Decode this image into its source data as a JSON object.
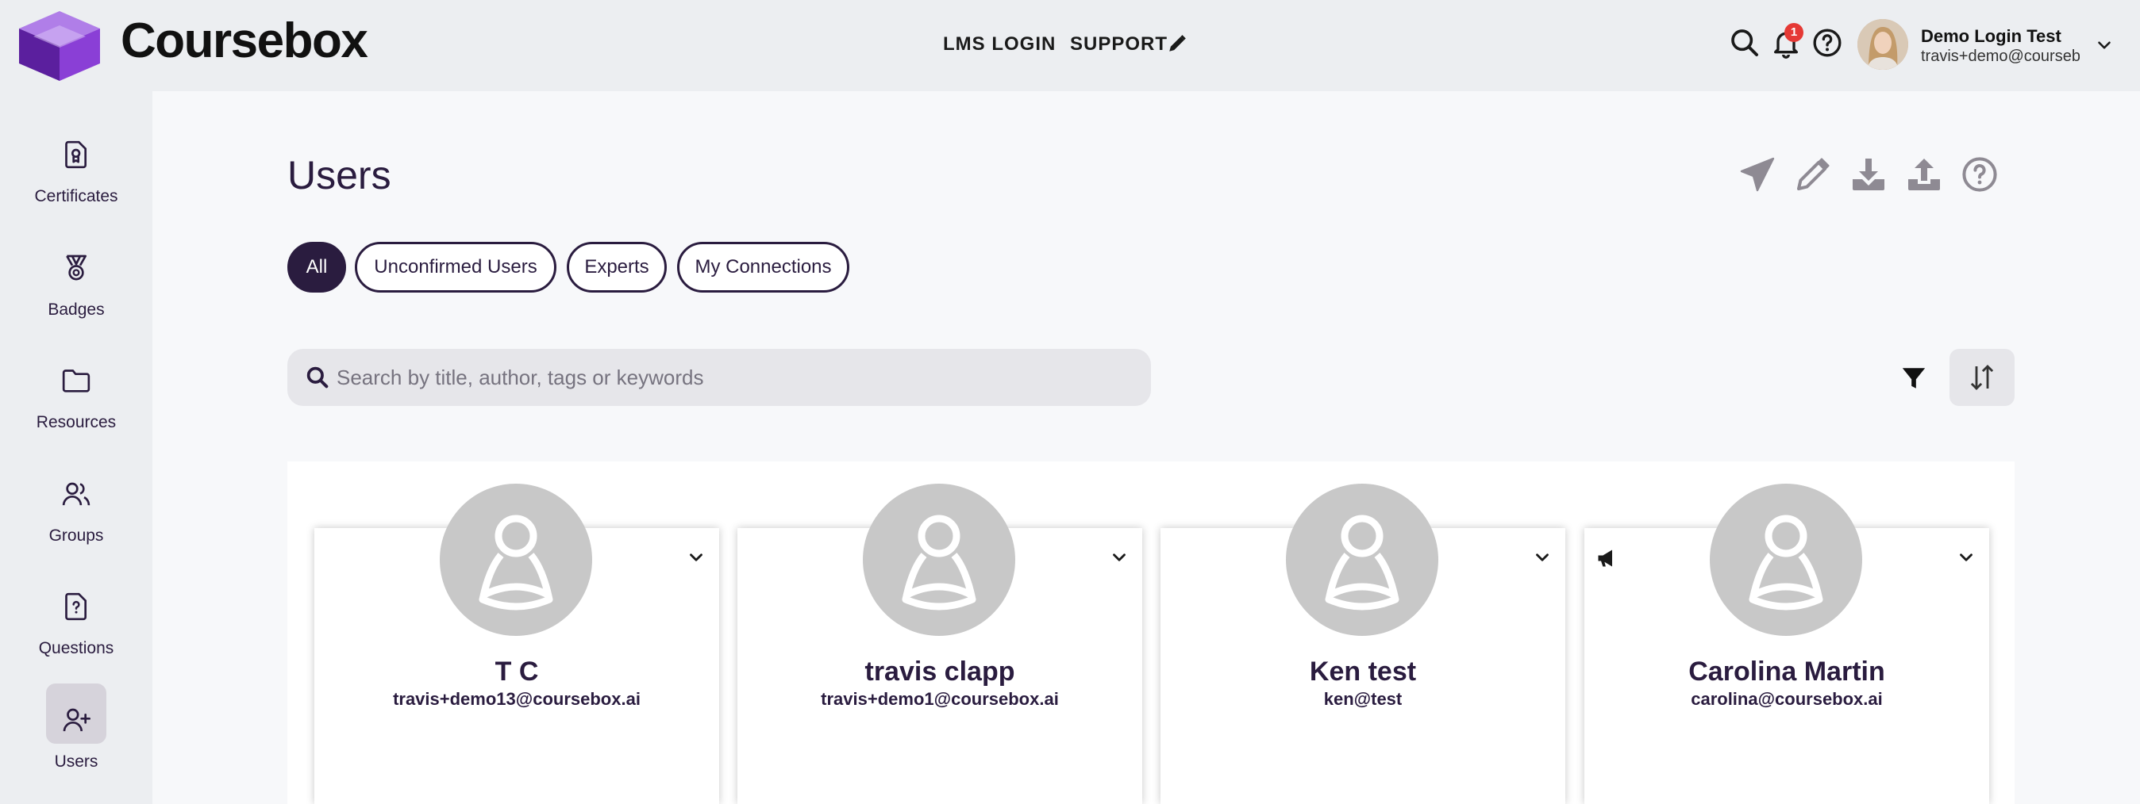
{
  "app": {
    "name": "Coursebox"
  },
  "header": {
    "nav": [
      {
        "label": "LMS LOGIN"
      },
      {
        "label": "SUPPORT"
      }
    ],
    "notifications_count": "1",
    "user": {
      "name": "Demo Login Test",
      "email": "travis+demo@courseb..."
    }
  },
  "sidebar": {
    "items": [
      {
        "label": "Certificates",
        "icon": "certificate-icon"
      },
      {
        "label": "Badges",
        "icon": "medal-icon"
      },
      {
        "label": "Resources",
        "icon": "folder-icon"
      },
      {
        "label": "Groups",
        "icon": "groups-icon"
      },
      {
        "label": "Questions",
        "icon": "question-file-icon"
      },
      {
        "label": "Users",
        "icon": "add-user-icon",
        "active": true
      }
    ]
  },
  "page": {
    "title": "Users",
    "tabs": [
      {
        "label": "All",
        "active": true
      },
      {
        "label": "Unconfirmed Users"
      },
      {
        "label": "Experts"
      },
      {
        "label": "My Connections"
      }
    ],
    "search": {
      "placeholder": "Search by title, author, tags or keywords",
      "value": ""
    },
    "users": [
      {
        "name": "T C",
        "email": "travis+demo13@coursebox.ai"
      },
      {
        "name": "travis clapp",
        "email": "travis+demo1@coursebox.ai"
      },
      {
        "name": "Ken test",
        "email": "ken@test"
      },
      {
        "name": "Carolina Martin",
        "email": "carolina@coursebox.ai"
      }
    ]
  },
  "colors": {
    "brand_dark": "#2a1c3f",
    "brand_purple": "#7b3fc4",
    "header_bg": "#eceef1",
    "notification_red": "#e53935",
    "avatar_placeholder": "#c8c8c8"
  }
}
